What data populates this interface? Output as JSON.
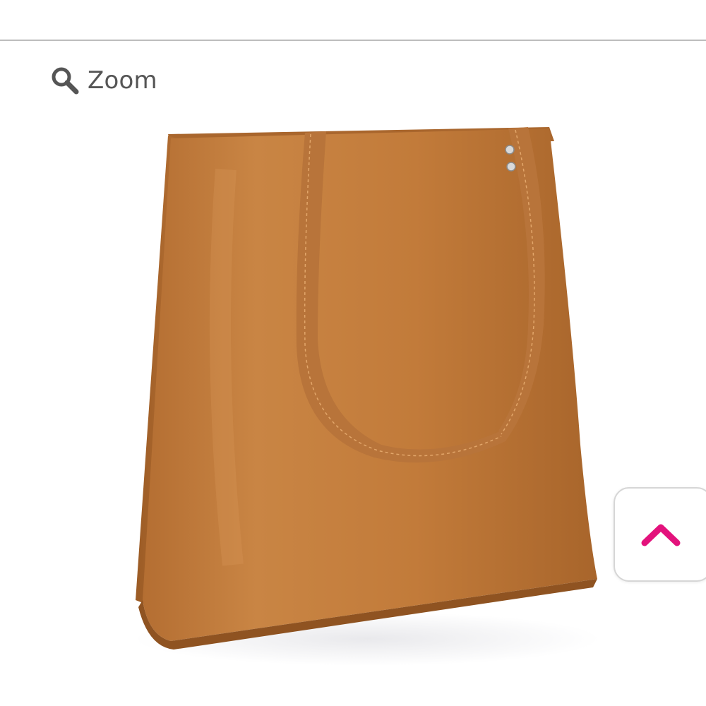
{
  "toolbar": {
    "zoom_label": "Zoom",
    "zoom_icon": "magnifier-icon"
  },
  "product": {
    "image_description_icon": "tote-bag-image",
    "colors": {
      "leather": "#c17a3c",
      "leather_shadow": "#9e5f28",
      "leather_highlight": "#d08c4c"
    }
  },
  "scroll_top": {
    "icon": "chevron-up-icon",
    "accent_color": "#e3127c"
  }
}
